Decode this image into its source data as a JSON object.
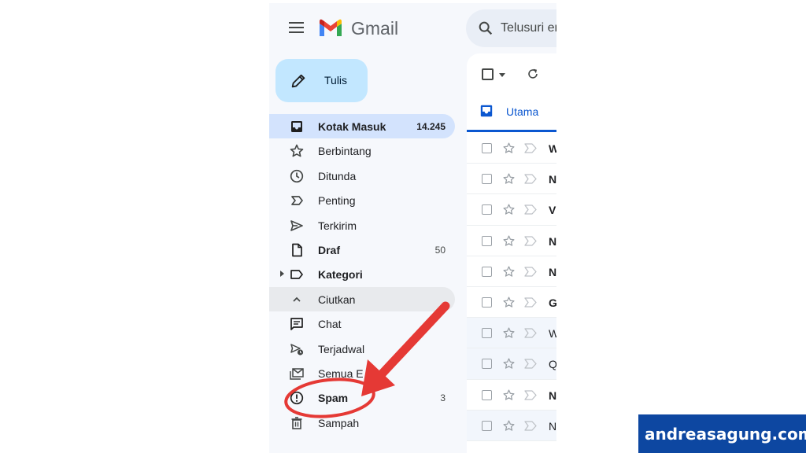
{
  "app": {
    "brand": "Gmail",
    "search_placeholder": "Telusuri em"
  },
  "compose": {
    "label": "Tulis"
  },
  "sidebar": {
    "items": [
      {
        "label": "Kotak Masuk",
        "count": "14.245",
        "icon": "inbox-icon"
      },
      {
        "label": "Berbintang",
        "count": "",
        "icon": "star-icon"
      },
      {
        "label": "Ditunda",
        "count": "",
        "icon": "clock-icon"
      },
      {
        "label": "Penting",
        "count": "",
        "icon": "important-icon"
      },
      {
        "label": "Terkirim",
        "count": "",
        "icon": "send-icon"
      },
      {
        "label": "Draf",
        "count": "50",
        "icon": "draft-icon"
      },
      {
        "label": "Kategori",
        "count": "",
        "icon": "label-icon"
      },
      {
        "label": "Ciutkan",
        "count": "",
        "icon": "chevron-up-icon"
      },
      {
        "label": "Chat",
        "count": "",
        "icon": "chat-icon"
      },
      {
        "label": "Terjadwal",
        "count": "",
        "icon": "scheduled-send-icon"
      },
      {
        "label": "Semua E",
        "count": "",
        "icon": "all-mail-icon"
      },
      {
        "label": "Spam",
        "count": "3",
        "icon": "spam-icon"
      },
      {
        "label": "Sampah",
        "count": "",
        "icon": "trash-icon"
      }
    ]
  },
  "main": {
    "tab_label": "Utama",
    "rows": [
      {
        "sender": "W"
      },
      {
        "sender": "N"
      },
      {
        "sender": "Vi"
      },
      {
        "sender": "N"
      },
      {
        "sender": "N"
      },
      {
        "sender": "G"
      },
      {
        "sender": "W"
      },
      {
        "sender": "Q"
      },
      {
        "sender": "N"
      },
      {
        "sender": "N"
      }
    ]
  },
  "watermark": {
    "text": "andreasagung.com"
  },
  "colors": {
    "compose_bg": "#c2e7ff",
    "active_nav": "#d3e3fd",
    "tab_accent": "#0b57d0",
    "annotation": "#e53935",
    "watermark_bg": "#0d47a1"
  }
}
